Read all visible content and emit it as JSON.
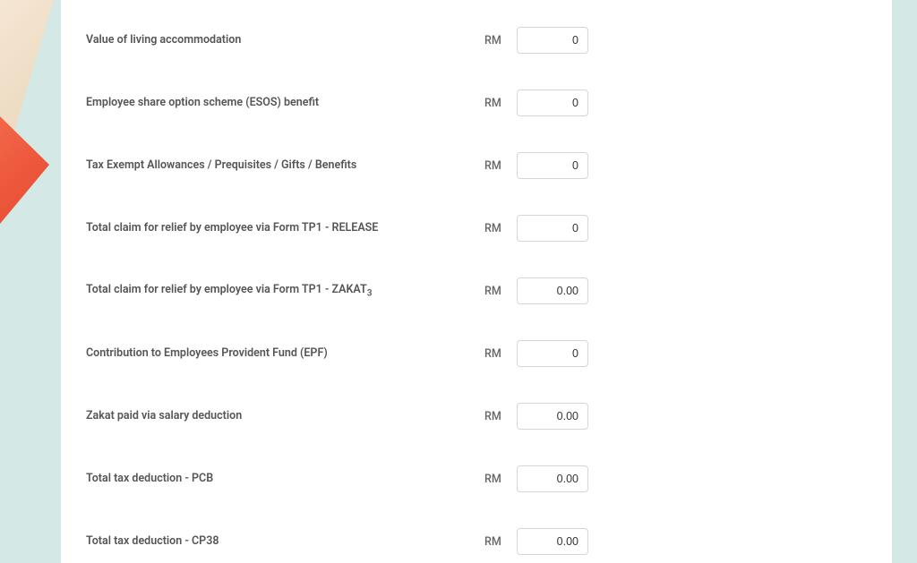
{
  "currency": "RM",
  "fields": [
    {
      "label": "Value of living accommodation",
      "value": "0"
    },
    {
      "label": "Employee share option scheme (ESOS) benefit",
      "value": "0"
    },
    {
      "label": "Tax Exempt Allowances / Prequisites / Gifts / Benefits",
      "value": "0"
    },
    {
      "label": "Total claim for relief by employee via Form TP1 - RELEASE",
      "value": "0"
    },
    {
      "label": "Total claim for relief by employee via Form TP1 - ZAKAT",
      "subscript": "3",
      "value": "0.00"
    },
    {
      "label": "Contribution to Employees Provident Fund (EPF)",
      "value": "0"
    },
    {
      "label": "Zakat paid via salary deduction",
      "value": "0.00"
    },
    {
      "label": "Total tax deduction - PCB",
      "value": "0.00"
    },
    {
      "label": "Total tax deduction - CP38",
      "value": "0.00"
    }
  ]
}
